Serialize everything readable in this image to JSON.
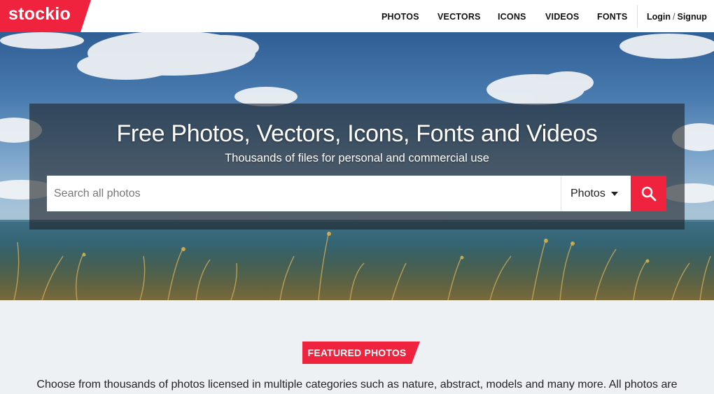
{
  "brand": {
    "logo_text": "stockio",
    "accent_color": "#f0233f"
  },
  "nav": {
    "items": [
      "PHOTOS",
      "VECTORS",
      "ICONS",
      "VIDEOS",
      "FONTS"
    ],
    "login": "Login",
    "separator": "/",
    "signup": "Signup"
  },
  "hero": {
    "title": "Free Photos, Vectors, Icons, Fonts and Videos",
    "subtitle": "Thousands of files for personal and commercial use"
  },
  "search": {
    "placeholder": "Search all photos",
    "value": "",
    "category": "Photos",
    "button_icon": "search-icon"
  },
  "featured": {
    "badge": "FEATURED PHOTOS",
    "intro": "Choose from thousands of photos licensed in multiple categories such as nature, abstract, models and many more. All photos are"
  }
}
